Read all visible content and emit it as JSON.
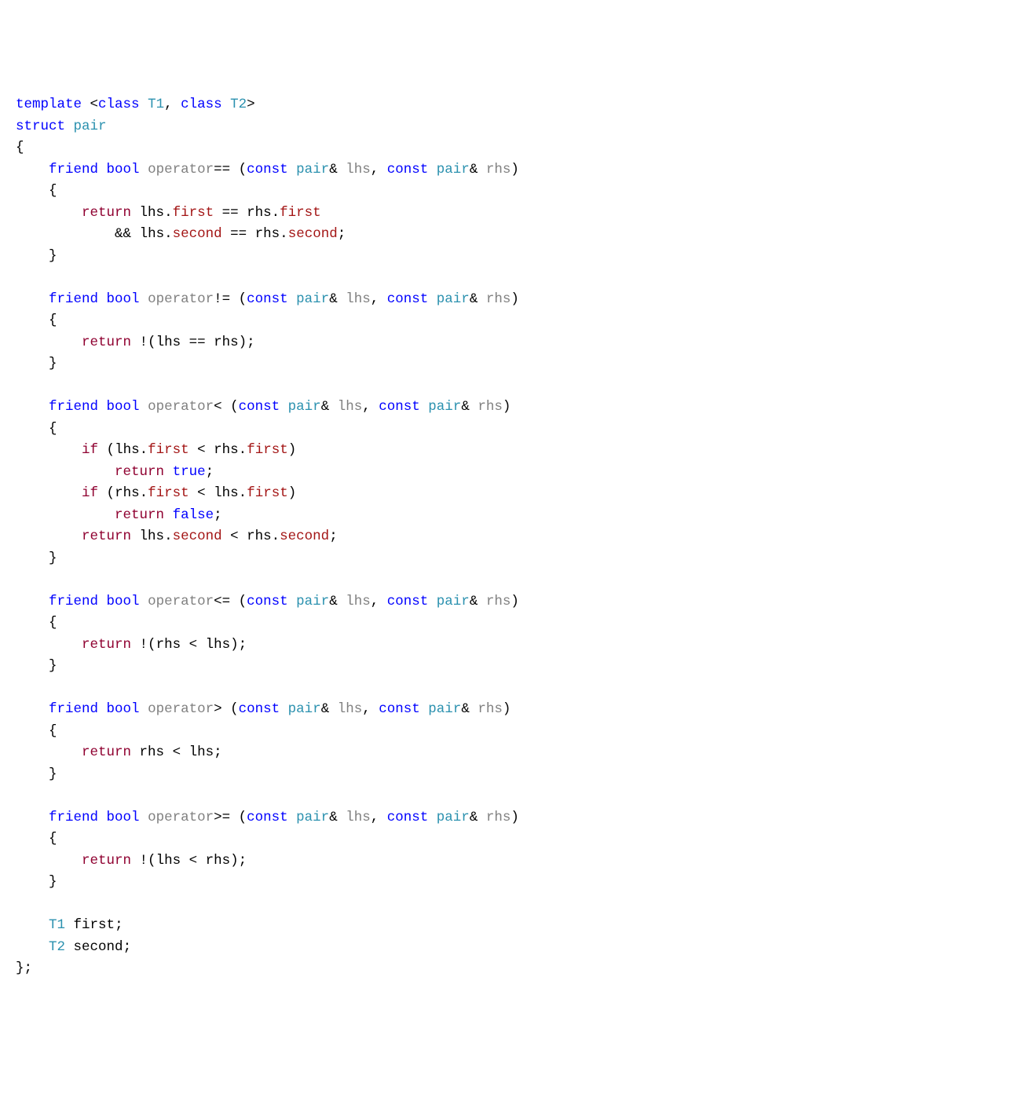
{
  "kw": {
    "template": "template",
    "class": "class",
    "struct": "struct",
    "friend": "friend",
    "bool": "bool",
    "const": "const",
    "true": "true",
    "false": "false"
  },
  "ty": {
    "T1": "T1",
    "T2": "T2",
    "pair": "pair"
  },
  "op": {
    "eq": "operator",
    "ne": "operator",
    "lt": "operator",
    "le": "operator",
    "gt": "operator",
    "ge": "operator"
  },
  "sym": {
    "eq": "==",
    "ne": "!=",
    "lt": "<",
    "le": "<=",
    "gt": ">",
    "ge": ">="
  },
  "rt": {
    "return": "return",
    "if": "if"
  },
  "mb": {
    "first": "first",
    "second": "second"
  },
  "va": {
    "lhs": "lhs",
    "rhs": "rhs"
  }
}
